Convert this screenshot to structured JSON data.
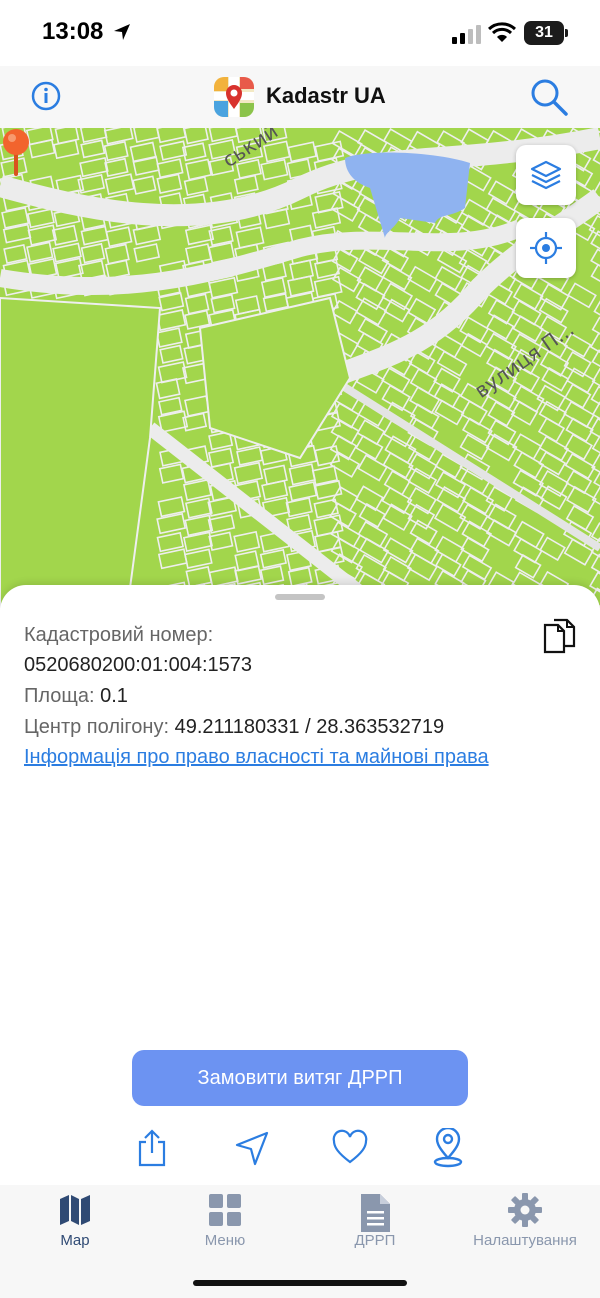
{
  "status_bar": {
    "time": "13:08",
    "battery": "31"
  },
  "header": {
    "title": "Kadastr UA"
  },
  "map": {
    "street_labels": [
      "ський",
      "вулиця П..."
    ],
    "colors": {
      "parcel": "#a2d64c",
      "road": "#ececec",
      "water": "#8fb3f0",
      "pin": "#f2642d"
    }
  },
  "parcel": {
    "cadastral_label": "Кадастровий номер:",
    "cadastral_number": "0520680200:01:004:1573",
    "area_label": "Площа:",
    "area_value": "0.1",
    "center_label": "Центр полігону:",
    "center_value": "49.211180331 / 28.363532719",
    "rights_link": "Інформація про право власності та майнові права"
  },
  "order_button": "Замовити витяг ДРРП",
  "actions": [
    "share-icon",
    "navigate-icon",
    "favorite-icon",
    "location-pin-icon"
  ],
  "tabs": [
    {
      "label": "Map",
      "icon": "map-icon",
      "active": true
    },
    {
      "label": "Меню",
      "icon": "grid-icon",
      "active": false
    },
    {
      "label": "ДРРП",
      "icon": "document-icon",
      "active": false
    },
    {
      "label": "Налаштування",
      "icon": "gear-icon",
      "active": false
    }
  ]
}
